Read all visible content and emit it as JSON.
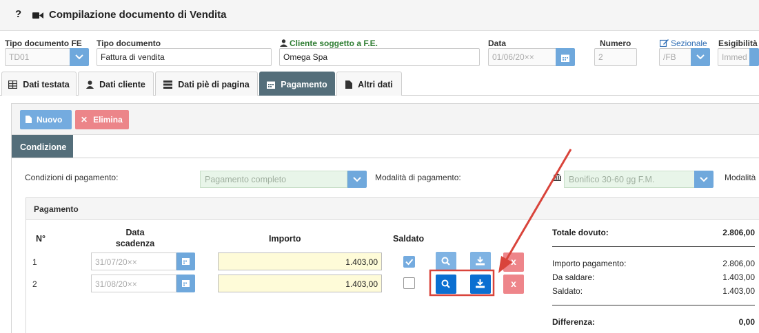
{
  "window": {
    "title": "Compilazione documento di Vendita",
    "help_icon": "?"
  },
  "header": {
    "tipo_fe": {
      "label": "Tipo documento FE",
      "value": "TD01"
    },
    "tipo_doc": {
      "label": "Tipo documento",
      "value": "Fattura di vendita"
    },
    "cliente": {
      "label": "Cliente soggetto a F.E.",
      "value": "Omega Spa"
    },
    "data": {
      "label": "Data",
      "value": "01/06/20××"
    },
    "numero": {
      "label": "Numero",
      "value": "2"
    },
    "sezionale": {
      "label": "Sezionale",
      "value": "/FB"
    },
    "esigibilita": {
      "label": "Esigibilità",
      "value": "Immed"
    }
  },
  "tabs": [
    {
      "label": "Dati testata",
      "icon": "table-icon"
    },
    {
      "label": "Dati cliente",
      "icon": "user-icon"
    },
    {
      "label": "Dati piè di pagina",
      "icon": "server-icon"
    },
    {
      "label": "Pagamento",
      "icon": "calendar-icon",
      "active": true
    },
    {
      "label": "Altri dati",
      "icon": "file-icon"
    }
  ],
  "toolbar": {
    "new_label": "Nuovo",
    "delete_label": "Elimina"
  },
  "subtab": {
    "label": "Condizione"
  },
  "conditions": {
    "cond_label": "Condizioni di pagamento:",
    "cond_value": "Pagamento completo",
    "mod_label": "Modalità di pagamento:",
    "mod_value": "Bonifico 30-60 gg F.M.",
    "mod2_label": "Modalità"
  },
  "payment": {
    "title": "Pagamento",
    "columns": {
      "n": "N°",
      "data": "Data scadenza",
      "importo": "Importo",
      "saldato": "Saldato"
    },
    "rows": [
      {
        "n": "1",
        "date": "31/07/20××",
        "amount": "1.403,00",
        "saldato": true
      },
      {
        "n": "2",
        "date": "31/08/20××",
        "amount": "1.403,00",
        "saldato": false
      }
    ],
    "delete_symbol": "x"
  },
  "totals": {
    "totale_label": "Totale dovuto:",
    "totale_value": "2.806,00",
    "importo_label": "Importo pagamento:",
    "importo_value": "2.806,00",
    "saldare_label": "Da saldare:",
    "saldare_value": "1.403,00",
    "saldato_label": "Saldato:",
    "saldato_value": "1.403,00",
    "diff_label": "Differenza:",
    "diff_value": "0,00"
  },
  "colors": {
    "accent": "#546e7a",
    "primary": "#0b6fd1",
    "danger": "#ee858a",
    "annotation": "#d9443b"
  }
}
